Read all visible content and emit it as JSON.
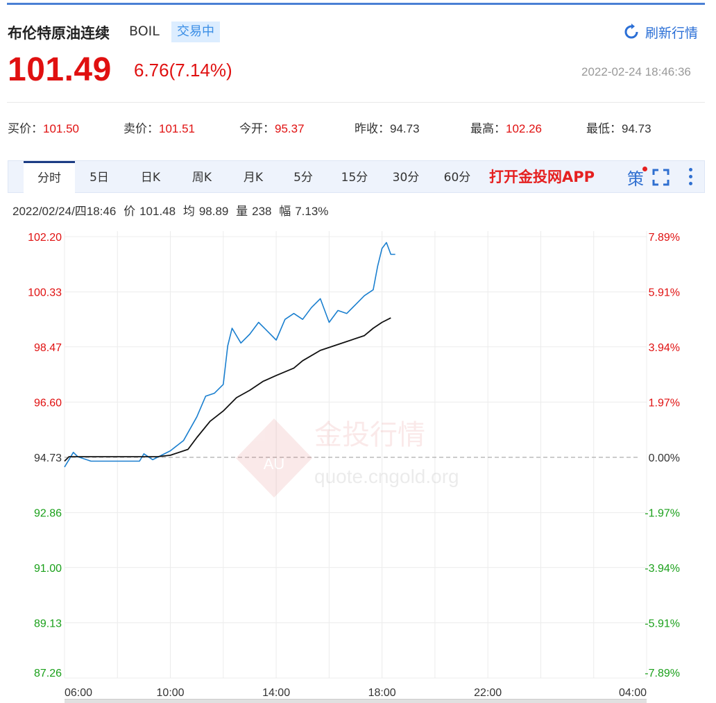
{
  "header": {
    "name": "布伦特原油连续",
    "code": "BOIL",
    "status": "交易中",
    "refresh_label": "刷新行情",
    "price": "101.49",
    "change": "6.76(7.14%)",
    "datetime": "2022-02-24 18:46:36"
  },
  "quotes": [
    {
      "label": "买价：",
      "value": "101.50",
      "color": "#e01010"
    },
    {
      "label": "卖价：",
      "value": "101.51",
      "color": "#e01010"
    },
    {
      "label": "今开：",
      "value": "95.37",
      "color": "#e01010"
    },
    {
      "label": "昨收：",
      "value": "94.73",
      "color": "#333333"
    },
    {
      "label": "最高：",
      "value": "102.26",
      "color": "#e01010"
    },
    {
      "label": "最低：",
      "value": "94.73",
      "color": "#333333"
    }
  ],
  "tabs": [
    "分时",
    "5日",
    "日K",
    "周K",
    "月K",
    "5分",
    "15分",
    "30分",
    "60分"
  ],
  "active_tab": "分时",
  "open_app_label": "打开金投网APP",
  "strategy_icon_label": "策",
  "info_bar": {
    "datetime": "2022/02/24/四18:46",
    "price_label": "价",
    "price": "101.48",
    "avg_label": "均",
    "avg": "98.89",
    "vol_label": "量",
    "vol": "238",
    "range_label": "幅",
    "range": "7.13%"
  },
  "watermark": {
    "brand": "金投行情",
    "url": "quote.cngold.org",
    "logo_text": "AU"
  },
  "colors": {
    "up": "#e01010",
    "down": "#1aa01a",
    "price_line": "#1a7fcf",
    "avg_line": "#111111",
    "accent": "#2f6fd0"
  },
  "chart_data": {
    "type": "line",
    "x_unit": "time",
    "x_ticks": [
      "06:00",
      "10:00",
      "14:00",
      "18:00",
      "22:00",
      "04:00"
    ],
    "y_left_ticks": [
      "102.20",
      "100.33",
      "98.47",
      "96.60",
      "94.73",
      "92.86",
      "91.00",
      "89.13",
      "87.26"
    ],
    "y_right_ticks": [
      "7.89%",
      "5.91%",
      "3.94%",
      "1.97%",
      "0.00%",
      "-1.97%",
      "-3.94%",
      "-5.91%",
      "-7.89%"
    ],
    "ylim": [
      87.26,
      102.2
    ],
    "reference_value": 94.73,
    "grid": true,
    "series": [
      {
        "role": "price",
        "color": "#1a7fcf",
        "points": [
          [
            "06:00",
            94.4
          ],
          [
            "06:10",
            94.65
          ],
          [
            "06:20",
            94.9
          ],
          [
            "06:30",
            94.75
          ],
          [
            "07:00",
            94.6
          ],
          [
            "08:00",
            94.6
          ],
          [
            "08:50",
            94.6
          ],
          [
            "09:00",
            94.85
          ],
          [
            "09:20",
            94.65
          ],
          [
            "09:40",
            94.8
          ],
          [
            "10:00",
            94.95
          ],
          [
            "10:30",
            95.3
          ],
          [
            "11:00",
            96.1
          ],
          [
            "11:20",
            96.8
          ],
          [
            "11:40",
            96.9
          ],
          [
            "12:00",
            97.2
          ],
          [
            "12:10",
            98.5
          ],
          [
            "12:20",
            99.1
          ],
          [
            "12:40",
            98.6
          ],
          [
            "13:00",
            98.9
          ],
          [
            "13:20",
            99.3
          ],
          [
            "13:40",
            99.0
          ],
          [
            "14:00",
            98.7
          ],
          [
            "14:20",
            99.4
          ],
          [
            "14:40",
            99.6
          ],
          [
            "15:00",
            99.4
          ],
          [
            "15:20",
            99.8
          ],
          [
            "15:40",
            100.1
          ],
          [
            "16:00",
            99.3
          ],
          [
            "16:20",
            99.7
          ],
          [
            "16:40",
            99.6
          ],
          [
            "17:00",
            99.9
          ],
          [
            "17:20",
            100.2
          ],
          [
            "17:40",
            100.4
          ],
          [
            "17:50",
            101.2
          ],
          [
            "18:00",
            101.8
          ],
          [
            "18:10",
            102.0
          ],
          [
            "18:20",
            101.6
          ],
          [
            "18:30",
            101.6
          ]
        ]
      },
      {
        "role": "average",
        "color": "#111111",
        "points": [
          [
            "06:00",
            94.6
          ],
          [
            "06:10",
            94.75
          ],
          [
            "09:30",
            94.75
          ],
          [
            "10:00",
            94.8
          ],
          [
            "10:40",
            95.0
          ],
          [
            "11:00",
            95.4
          ],
          [
            "11:30",
            95.95
          ],
          [
            "12:00",
            96.3
          ],
          [
            "12:30",
            96.75
          ],
          [
            "13:00",
            97.0
          ],
          [
            "13:30",
            97.3
          ],
          [
            "14:00",
            97.5
          ],
          [
            "14:40",
            97.75
          ],
          [
            "15:00",
            98.0
          ],
          [
            "15:40",
            98.35
          ],
          [
            "16:00",
            98.45
          ],
          [
            "16:40",
            98.65
          ],
          [
            "17:20",
            98.85
          ],
          [
            "17:40",
            99.1
          ],
          [
            "18:00",
            99.3
          ],
          [
            "18:20",
            99.45
          ]
        ]
      }
    ]
  }
}
